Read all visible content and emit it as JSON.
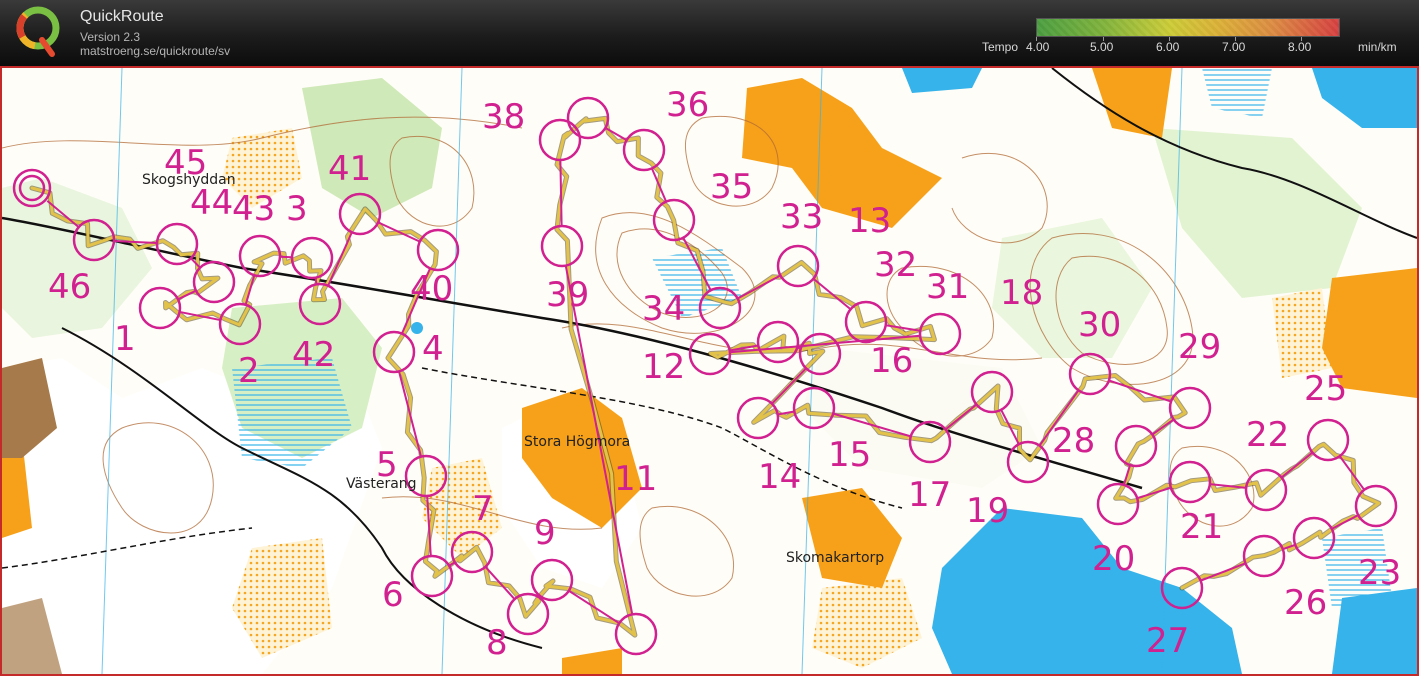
{
  "app": {
    "title": "QuickRoute",
    "version": "Version 2.3",
    "url": "matstroeng.se/quickroute/sv",
    "logo_letter": "Q"
  },
  "legend": {
    "label": "Tempo",
    "ticks": [
      "4.00",
      "5.00",
      "6.00",
      "7.00",
      "8.00"
    ],
    "unit": "min/km"
  },
  "map": {
    "place_names": [
      "Skogshyddan",
      "Stora Högmora",
      "Västerang",
      "Skomakartorp"
    ],
    "control_numbers": [
      "1",
      "2",
      "3",
      "4",
      "5",
      "6",
      "7",
      "8",
      "9",
      "11",
      "12",
      "13",
      "14",
      "15",
      "16",
      "17",
      "18",
      "19",
      "20",
      "21",
      "22",
      "23",
      "25",
      "26",
      "27",
      "28",
      "29",
      "30",
      "31",
      "32",
      "33",
      "34",
      "35",
      "36",
      "38",
      "39",
      "40",
      "41",
      "42",
      "43",
      "44",
      "45",
      "46"
    ],
    "colors": {
      "control": "#d1208f",
      "water": "#35b3ea",
      "open": "#f9a21b",
      "forest": "#c9e7b0",
      "contour": "#b06a35",
      "route": "#c8a13a",
      "frame": "#c52a2a"
    }
  }
}
